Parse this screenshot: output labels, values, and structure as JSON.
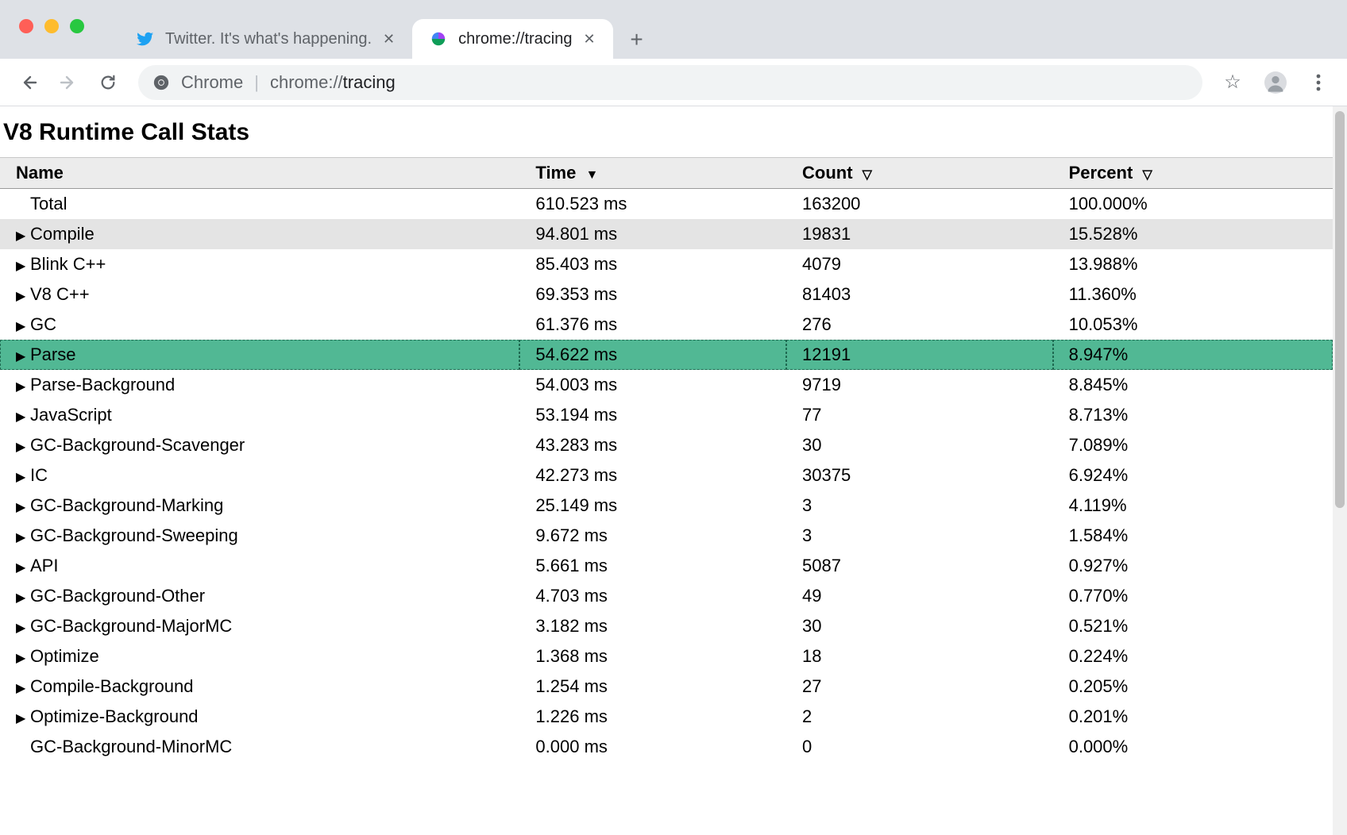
{
  "window": {
    "tabs": [
      {
        "title": "Twitter. It's what's happening.",
        "favicon": "twitter",
        "active": false
      },
      {
        "title": "chrome://tracing",
        "favicon": "tracing",
        "active": true
      }
    ]
  },
  "toolbar": {
    "url_prefix": "Chrome",
    "url_scheme": "chrome://",
    "url_path": "tracing"
  },
  "page": {
    "title": "V8 Runtime Call Stats",
    "columns": {
      "name": "Name",
      "time": "Time",
      "count": "Count",
      "percent": "Percent"
    },
    "sort": {
      "column": "time",
      "direction": "desc"
    },
    "rows": [
      {
        "name": "Total",
        "time": "610.523 ms",
        "count": "163200",
        "percent": "100.000%",
        "expandable": false
      },
      {
        "name": "Compile",
        "time": "94.801 ms",
        "count": "19831",
        "percent": "15.528%",
        "expandable": true,
        "highlight": "compile"
      },
      {
        "name": "Blink C++",
        "time": "85.403 ms",
        "count": "4079",
        "percent": "13.988%",
        "expandable": true
      },
      {
        "name": "V8 C++",
        "time": "69.353 ms",
        "count": "81403",
        "percent": "11.360%",
        "expandable": true
      },
      {
        "name": "GC",
        "time": "61.376 ms",
        "count": "276",
        "percent": "10.053%",
        "expandable": true
      },
      {
        "name": "Parse",
        "time": "54.622 ms",
        "count": "12191",
        "percent": "8.947%",
        "expandable": true,
        "highlight": "parse"
      },
      {
        "name": "Parse-Background",
        "time": "54.003 ms",
        "count": "9719",
        "percent": "8.845%",
        "expandable": true
      },
      {
        "name": "JavaScript",
        "time": "53.194 ms",
        "count": "77",
        "percent": "8.713%",
        "expandable": true
      },
      {
        "name": "GC-Background-Scavenger",
        "time": "43.283 ms",
        "count": "30",
        "percent": "7.089%",
        "expandable": true
      },
      {
        "name": "IC",
        "time": "42.273 ms",
        "count": "30375",
        "percent": "6.924%",
        "expandable": true
      },
      {
        "name": "GC-Background-Marking",
        "time": "25.149 ms",
        "count": "3",
        "percent": "4.119%",
        "expandable": true
      },
      {
        "name": "GC-Background-Sweeping",
        "time": "9.672 ms",
        "count": "3",
        "percent": "1.584%",
        "expandable": true
      },
      {
        "name": "API",
        "time": "5.661 ms",
        "count": "5087",
        "percent": "0.927%",
        "expandable": true
      },
      {
        "name": "GC-Background-Other",
        "time": "4.703 ms",
        "count": "49",
        "percent": "0.770%",
        "expandable": true
      },
      {
        "name": "GC-Background-MajorMC",
        "time": "3.182 ms",
        "count": "30",
        "percent": "0.521%",
        "expandable": true
      },
      {
        "name": "Optimize",
        "time": "1.368 ms",
        "count": "18",
        "percent": "0.224%",
        "expandable": true
      },
      {
        "name": "Compile-Background",
        "time": "1.254 ms",
        "count": "27",
        "percent": "0.205%",
        "expandable": true
      },
      {
        "name": "Optimize-Background",
        "time": "1.226 ms",
        "count": "2",
        "percent": "0.201%",
        "expandable": true
      },
      {
        "name": "GC-Background-MinorMC",
        "time": "0.000 ms",
        "count": "0",
        "percent": "0.000%",
        "expandable": false
      }
    ]
  }
}
